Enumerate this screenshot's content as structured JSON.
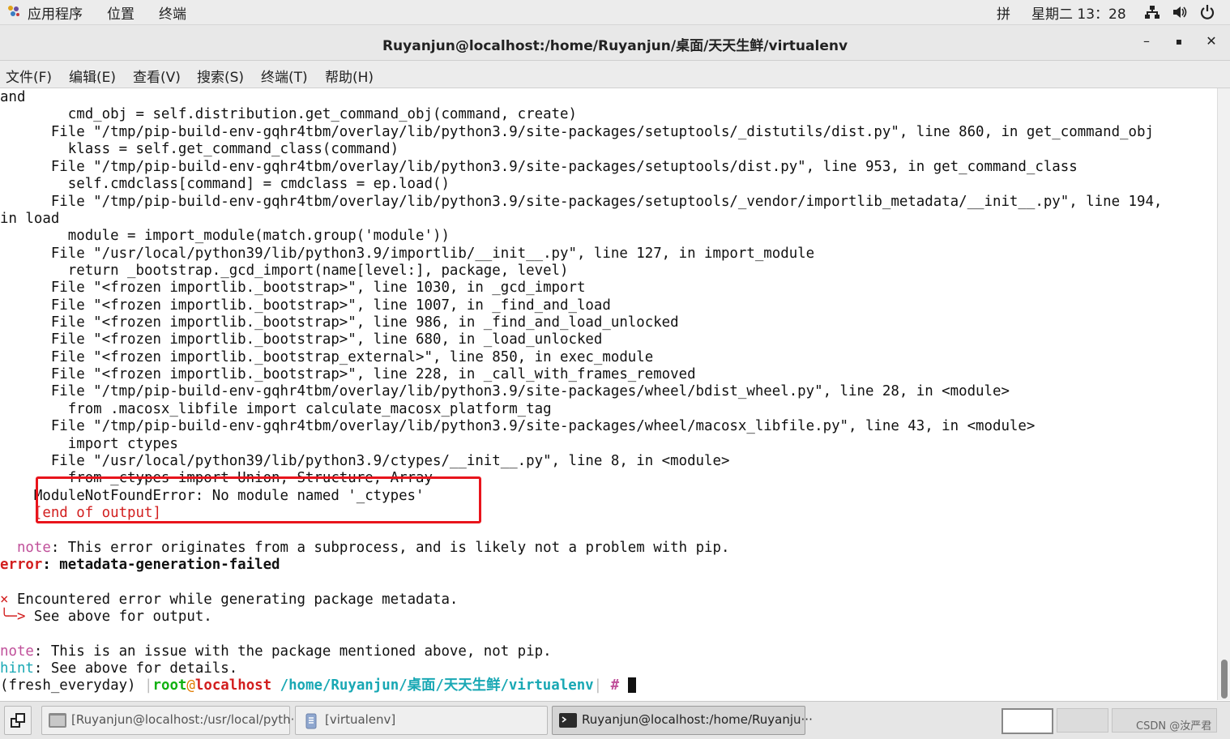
{
  "topbar": {
    "apps": "应用程序",
    "places": "位置",
    "terminal": "终端",
    "input_method": "拼",
    "clock": "星期二 13：28"
  },
  "window": {
    "title": "Ruyanjun@localhost:/home/Ruyanjun/桌面/天天生鲜/virtualenv",
    "min": "–",
    "max": "▪",
    "close": "✕"
  },
  "menu": [
    "文件(F)",
    "编辑(E)",
    "查看(V)",
    "搜索(S)",
    "终端(T)",
    "帮助(H)"
  ],
  "terminal": {
    "l0": "and",
    "l1": "        cmd_obj = self.distribution.get_command_obj(command, create)",
    "l2": "      File \"/tmp/pip-build-env-gqhr4tbm/overlay/lib/python3.9/site-packages/setuptools/_distutils/dist.py\", line 860, in get_command_obj",
    "l3": "        klass = self.get_command_class(command)",
    "l4": "      File \"/tmp/pip-build-env-gqhr4tbm/overlay/lib/python3.9/site-packages/setuptools/dist.py\", line 953, in get_command_class",
    "l5": "        self.cmdclass[command] = cmdclass = ep.load()",
    "l6": "      File \"/tmp/pip-build-env-gqhr4tbm/overlay/lib/python3.9/site-packages/setuptools/_vendor/importlib_metadata/__init__.py\", line 194,",
    "l7": "in load",
    "l8": "        module = import_module(match.group('module'))",
    "l9": "      File \"/usr/local/python39/lib/python3.9/importlib/__init__.py\", line 127, in import_module",
    "l10": "        return _bootstrap._gcd_import(name[level:], package, level)",
    "l11": "      File \"<frozen importlib._bootstrap>\", line 1030, in _gcd_import",
    "l12": "      File \"<frozen importlib._bootstrap>\", line 1007, in _find_and_load",
    "l13": "      File \"<frozen importlib._bootstrap>\", line 986, in _find_and_load_unlocked",
    "l14": "      File \"<frozen importlib._bootstrap>\", line 680, in _load_unlocked",
    "l15": "      File \"<frozen importlib._bootstrap_external>\", line 850, in exec_module",
    "l16": "      File \"<frozen importlib._bootstrap>\", line 228, in _call_with_frames_removed",
    "l17": "      File \"/tmp/pip-build-env-gqhr4tbm/overlay/lib/python3.9/site-packages/wheel/bdist_wheel.py\", line 28, in <module>",
    "l18": "        from .macosx_libfile import calculate_macosx_platform_tag",
    "l19": "      File \"/tmp/pip-build-env-gqhr4tbm/overlay/lib/python3.9/site-packages/wheel/macosx_libfile.py\", line 43, in <module>",
    "l20": "        import ctypes",
    "l21": "      File \"/usr/local/python39/lib/python3.9/ctypes/__init__.py\", line 8, in <module>",
    "l22": "        from _ctypes import Union, Structure, Array",
    "l23": "    ModuleNotFoundError: No module named '_ctypes'",
    "l24": "    [end of output]",
    "note1_label": "note",
    "note1_text": ": This error originates from a subprocess, and is likely not a problem with pip.",
    "error_label": "error",
    "error_text": ": metadata-generation-failed",
    "x_mark": "×",
    "enc": " Encountered error while generating package metadata.",
    "arrow": "╰─>",
    "see": " See above for output.",
    "note2_label": "note",
    "note2_text": ": This is an issue with the package mentioned above, not pip.",
    "hint_label": "hint",
    "hint_text": ": See above for details.",
    "prompt_env": "(fresh_everyday)",
    "prompt_user": "root",
    "prompt_at": "@",
    "prompt_host": "localhost",
    "prompt_path": "/home/Ruyanjun/桌面/天天生鲜/virtualenv",
    "prompt_hash": "#"
  },
  "taskbar": {
    "t1": "[Ruyanjun@localhost:/usr/local/pyth···",
    "t2": "[virtualenv]",
    "t3": "Ruyanjun@localhost:/home/Ruyanju···",
    "watermark": "CSDN @汝严君"
  }
}
